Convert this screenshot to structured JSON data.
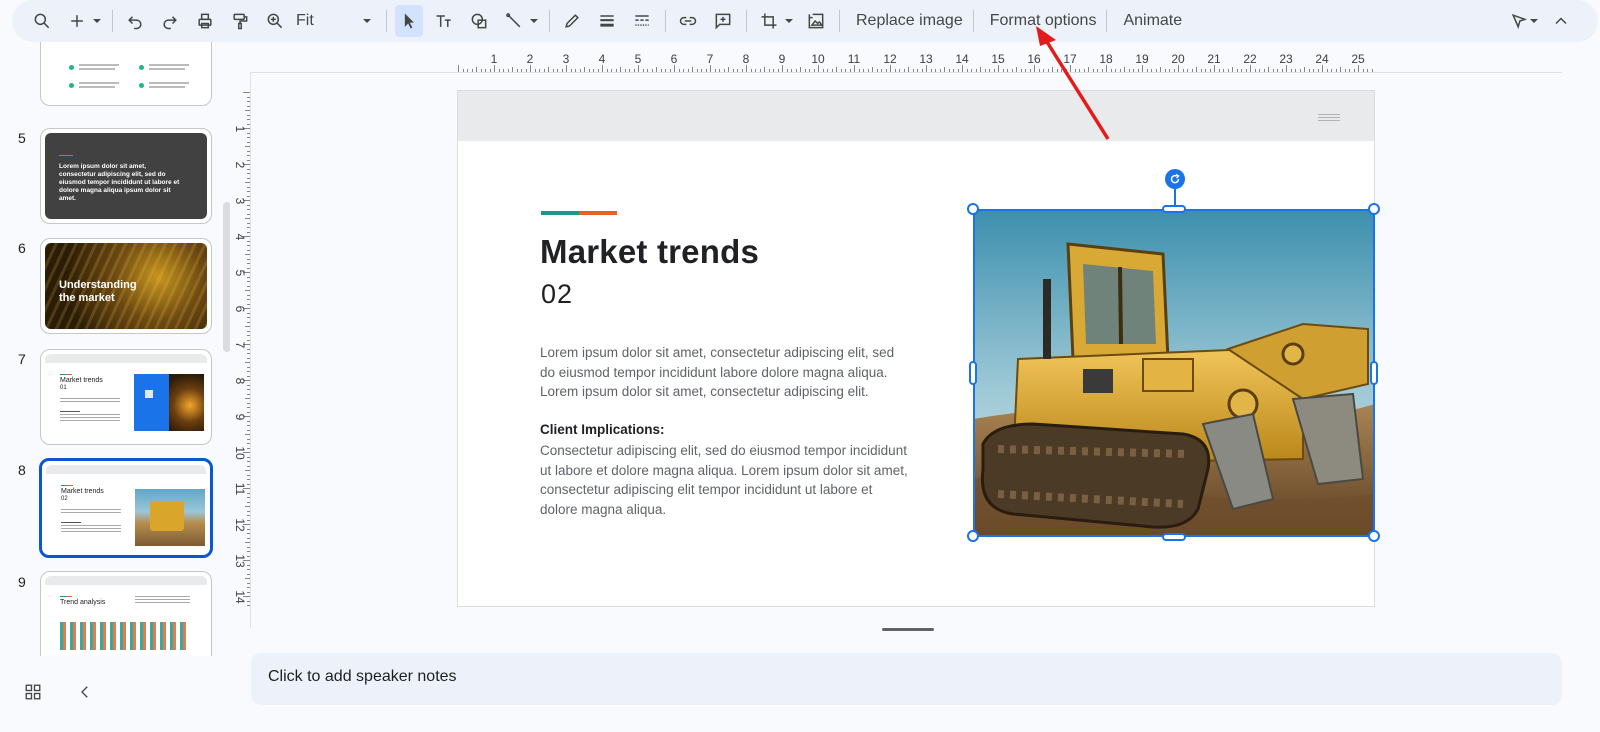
{
  "toolbar": {
    "zoom_value": "Fit",
    "replace_image_label": "Replace image",
    "format_options_label": "Format options",
    "animate_label": "Animate",
    "icons": [
      "search-icon",
      "add-icon",
      "undo-icon",
      "redo-icon",
      "print-icon",
      "paint-format-icon",
      "zoom-icon",
      "select-icon",
      "text-box-icon",
      "shape-icon",
      "line-icon",
      "pen-icon",
      "border-weight-icon",
      "border-dash-icon",
      "link-icon",
      "comment-icon",
      "crop-icon",
      "reset-image-icon",
      "editing-mode-icon",
      "collapse-icon"
    ]
  },
  "filmstrip": {
    "slides": [
      {
        "number": "5",
        "caption": "Lorem ipsum dolor sit amet, consectetur adipiscing elit, sed do eiusmod tempor incididunt ut labore et dolore magna aliqua ipsum dolor sit amet."
      },
      {
        "number": "6",
        "caption": "Understanding the market"
      },
      {
        "number": "7",
        "title": "Market trends",
        "sub": "01"
      },
      {
        "number": "8",
        "title": "Market trends",
        "sub": "02"
      },
      {
        "number": "9",
        "title": "Trend analysis"
      }
    ]
  },
  "ruler": {
    "h_labels": [
      "1",
      "2",
      "3",
      "4",
      "5",
      "6",
      "7",
      "8",
      "9",
      "10",
      "11",
      "12",
      "13",
      "14",
      "15",
      "16",
      "17",
      "18",
      "19",
      "20",
      "21",
      "22",
      "23",
      "24",
      "25"
    ],
    "v_labels": [
      "1",
      "2",
      "3",
      "4",
      "5",
      "6",
      "7",
      "8",
      "9",
      "10",
      "11",
      "12",
      "13",
      "14"
    ]
  },
  "slide": {
    "title": "Market trends",
    "subtitle": "02",
    "body1": "Lorem ipsum dolor sit amet, consectetur adipiscing elit, sed do eiusmod tempor incididunt labore dolore magna aliqua. Lorem ipsum dolor sit amet, consectetur adipiscing elit.",
    "body_heading": "Client Implications:",
    "body2": "Consectetur adipiscing elit, sed do eiusmod tempor incididunt ut labore et dolore magna aliqua. Lorem ipsum dolor sit amet, consectetur adipiscing elit tempor incididunt ut labore et dolore magna aliqua.",
    "accent_colors": [
      "#159b8c",
      "#e2622c"
    ]
  },
  "notes": {
    "placeholder": "Click to add speaker notes"
  },
  "colors": {
    "selection": "#1a73e8",
    "annotation_arrow": "#e21b1b"
  }
}
